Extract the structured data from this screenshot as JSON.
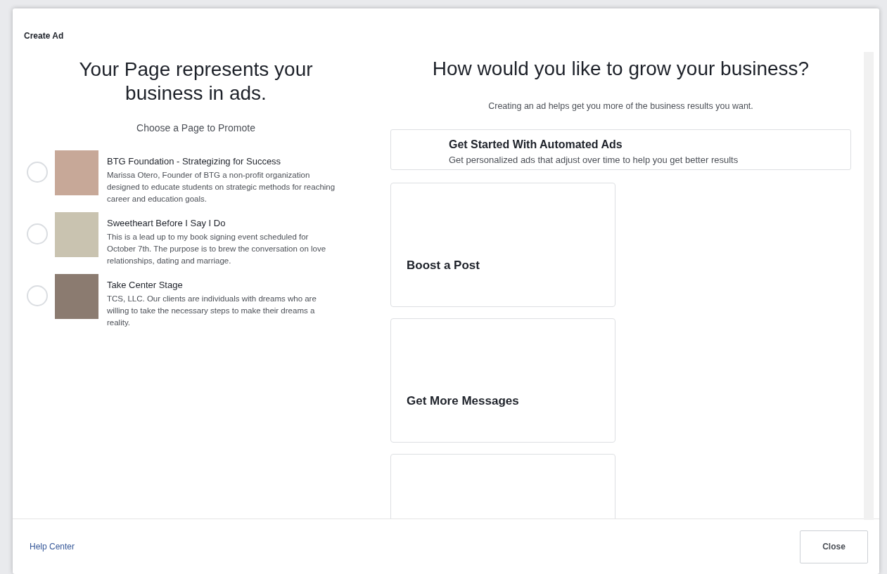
{
  "dialog": {
    "title": "Create Ad"
  },
  "pages_panel": {
    "heading": "Your Page represents your business in ads.",
    "subheading": "Choose a Page to Promote",
    "pages": [
      {
        "name": "BTG Foundation - Strategizing for Success",
        "description": "Marissa Otero, Founder of BTG a non-profit organization designed to educate students on strategic methods for reaching career and education goals.",
        "selected": false
      },
      {
        "name": "Sweetheart Before I Say I Do",
        "description": "This is a lead up to my book signing event scheduled for October 7th. The purpose is to brew the conversation on love relationships, dating and marriage.",
        "selected": false
      },
      {
        "name": "Take Center Stage",
        "description": "TCS, LLC. Our clients are individuals with dreams who are willing to take the necessary steps to make their dreams a reality.",
        "selected": false
      }
    ]
  },
  "goals_panel": {
    "heading": "How would you like to grow your business?",
    "subheading": "Creating an ad helps get you more of the business results you want.",
    "automated": {
      "title": "Get Started With Automated Ads",
      "description": "Get personalized ads that adjust over time to help you get better results"
    },
    "options": [
      {
        "kind": "goal",
        "label": "Boost a Post"
      },
      {
        "kind": "goal",
        "label": "Get More Messages"
      },
      {
        "kind": "blank"
      }
    ]
  },
  "footer": {
    "link": "Help Center",
    "button": "Close"
  }
}
